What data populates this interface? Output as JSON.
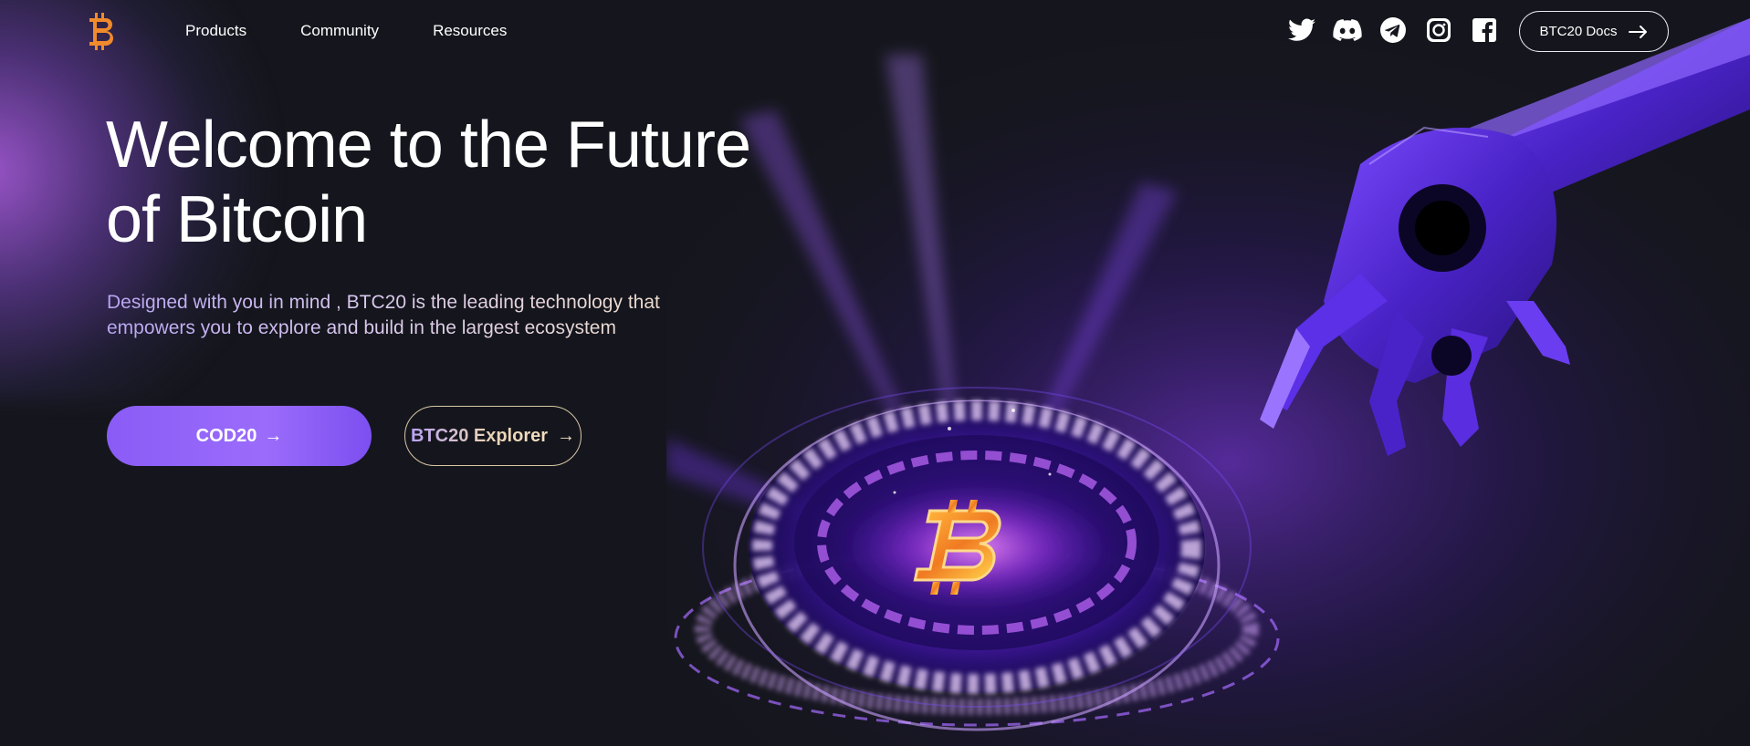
{
  "nav": {
    "logo": "btc20-logo",
    "links": [
      "Products",
      "Community",
      "Resources"
    ],
    "socials": [
      "twitter-icon",
      "discord-icon",
      "telegram-icon",
      "instagram-icon",
      "facebook-icon"
    ],
    "docs_label": "BTC20 Docs"
  },
  "hero": {
    "title": "Welcome to the Future of Bitcoin",
    "subtitle": "Designed with you in mind , BTC20 is the leading technology that empowers you to explore and build in the largest ecosystem",
    "primary_button": "COD20",
    "secondary_button": "BTC20 Explorer",
    "arrow": "→"
  },
  "colors": {
    "background": "#15161d",
    "accent_purple": "#8a5cf6",
    "logo_orange": "#f08a2c"
  }
}
